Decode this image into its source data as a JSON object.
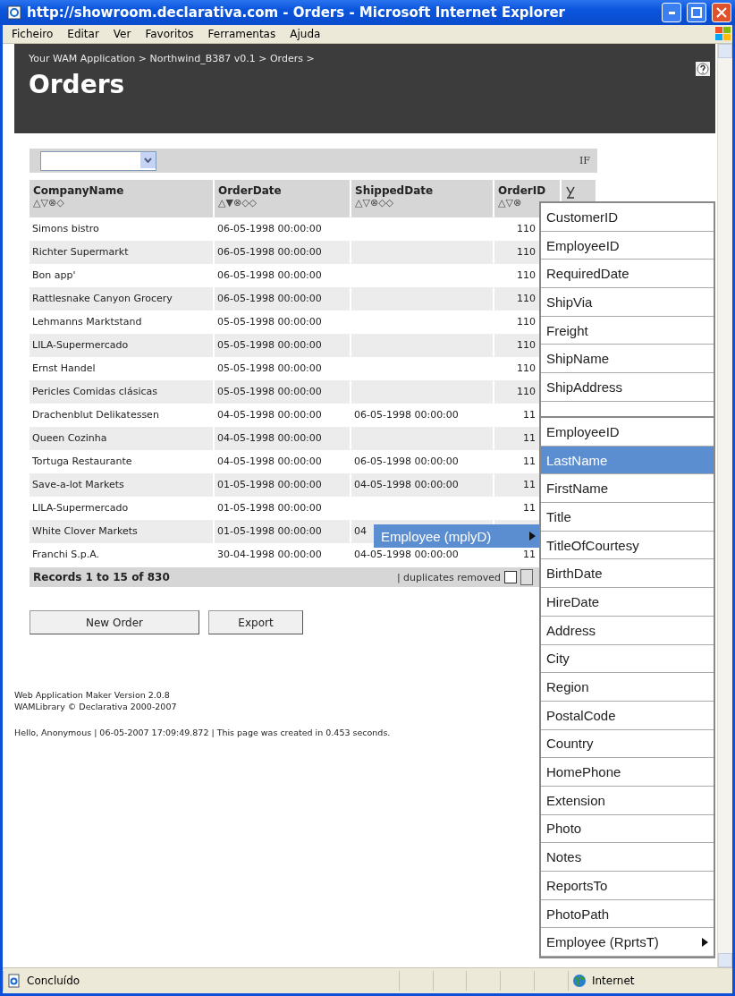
{
  "window": {
    "title": "http://showroom.declarativa.com - Orders - Microsoft Internet Explorer"
  },
  "menu_bar": [
    "Ficheiro",
    "Editar",
    "Ver",
    "Favoritos",
    "Ferramentas",
    "Ajuda"
  ],
  "breadcrumb": "Your WAM Application > Northwind_B387 v0.1 > Orders >",
  "page_title": "Orders",
  "filter": {
    "right_label": "IF"
  },
  "table": {
    "columns": [
      {
        "label": "CompanyName",
        "sort_icons": "△▽⊗◇"
      },
      {
        "label": "OrderDate",
        "sort_icons": "△▼⊗◇◇"
      },
      {
        "label": "ShippedDate",
        "sort_icons": "△▽⊗◇◇"
      },
      {
        "label": "OrderID",
        "sort_icons": "△▽⊗"
      }
    ],
    "rows": [
      [
        "Simons bistro",
        "06-05-1998 00:00:00",
        "",
        "110"
      ],
      [
        "Richter Supermarkt",
        "06-05-1998 00:00:00",
        "",
        "110"
      ],
      [
        "Bon app'",
        "06-05-1998 00:00:00",
        "",
        "110"
      ],
      [
        "Rattlesnake Canyon Grocery",
        "06-05-1998 00:00:00",
        "",
        "110"
      ],
      [
        "Lehmanns Marktstand",
        "05-05-1998 00:00:00",
        "",
        "110"
      ],
      [
        "LILA-Supermercado",
        "05-05-1998 00:00:00",
        "",
        "110"
      ],
      [
        "Ernst Handel",
        "05-05-1998 00:00:00",
        "",
        "110"
      ],
      [
        "Pericles Comidas clásicas",
        "05-05-1998 00:00:00",
        "",
        "110"
      ],
      [
        "Drachenblut Delikatessen",
        "04-05-1998 00:00:00",
        "06-05-1998 00:00:00",
        "11"
      ],
      [
        "Queen Cozinha",
        "04-05-1998 00:00:00",
        "",
        "11"
      ],
      [
        "Tortuga Restaurante",
        "04-05-1998 00:00:00",
        "06-05-1998 00:00:00",
        "11"
      ],
      [
        "Save-a-lot Markets",
        "01-05-1998 00:00:00",
        "04-05-1998 00:00:00",
        "11"
      ],
      [
        "LILA-Supermercado",
        "01-05-1998 00:00:00",
        "",
        "11"
      ],
      [
        "White Clover Markets",
        "01-05-1998 00:00:00",
        "04",
        ""
      ],
      [
        "Franchi S.p.A.",
        "30-04-1998 00:00:00",
        "04-05-1998 00:00:00",
        "11"
      ]
    ],
    "records": "Records 1 to 15 of 830",
    "duplicates_label": "| duplicates removed",
    "duplicates_checked": false
  },
  "buttons": [
    "New Order",
    "Export"
  ],
  "footer_lines": [
    "Web Application Maker Version 2.0.8",
    "WAMLibrary © Declarativa 2000-2007"
  ],
  "status_line": "Hello, Anonymous  |  06-05-2007 17:09:49.872 | This page was created in 0.453 seconds.",
  "column_menu": [
    "CustomerID",
    "EmployeeID",
    "RequiredDate",
    "ShipVia",
    "Freight",
    "ShipName",
    "ShipAddress"
  ],
  "relation_item": {
    "label": "Employee (mplyD)",
    "selected": true
  },
  "submenu": [
    {
      "label": "EmployeeID",
      "selected": false,
      "has_submenu": false
    },
    {
      "label": "LastName",
      "selected": true,
      "has_submenu": false
    },
    {
      "label": "FirstName",
      "selected": false,
      "has_submenu": false
    },
    {
      "label": "Title",
      "selected": false,
      "has_submenu": false
    },
    {
      "label": "TitleOfCourtesy",
      "selected": false,
      "has_submenu": false
    },
    {
      "label": "BirthDate",
      "selected": false,
      "has_submenu": false
    },
    {
      "label": "HireDate",
      "selected": false,
      "has_submenu": false
    },
    {
      "label": "Address",
      "selected": false,
      "has_submenu": false
    },
    {
      "label": "City",
      "selected": false,
      "has_submenu": false
    },
    {
      "label": "Region",
      "selected": false,
      "has_submenu": false
    },
    {
      "label": "PostalCode",
      "selected": false,
      "has_submenu": false
    },
    {
      "label": "Country",
      "selected": false,
      "has_submenu": false
    },
    {
      "label": "HomePhone",
      "selected": false,
      "has_submenu": false
    },
    {
      "label": "Extension",
      "selected": false,
      "has_submenu": false
    },
    {
      "label": "Photo",
      "selected": false,
      "has_submenu": false
    },
    {
      "label": "Notes",
      "selected": false,
      "has_submenu": false
    },
    {
      "label": "ReportsTo",
      "selected": false,
      "has_submenu": false
    },
    {
      "label": "PhotoPath",
      "selected": false,
      "has_submenu": false
    },
    {
      "label": "Employee (RprtsT)",
      "selected": false,
      "has_submenu": true
    }
  ],
  "status_bar": {
    "text": "Concluído",
    "zone": "Internet"
  }
}
